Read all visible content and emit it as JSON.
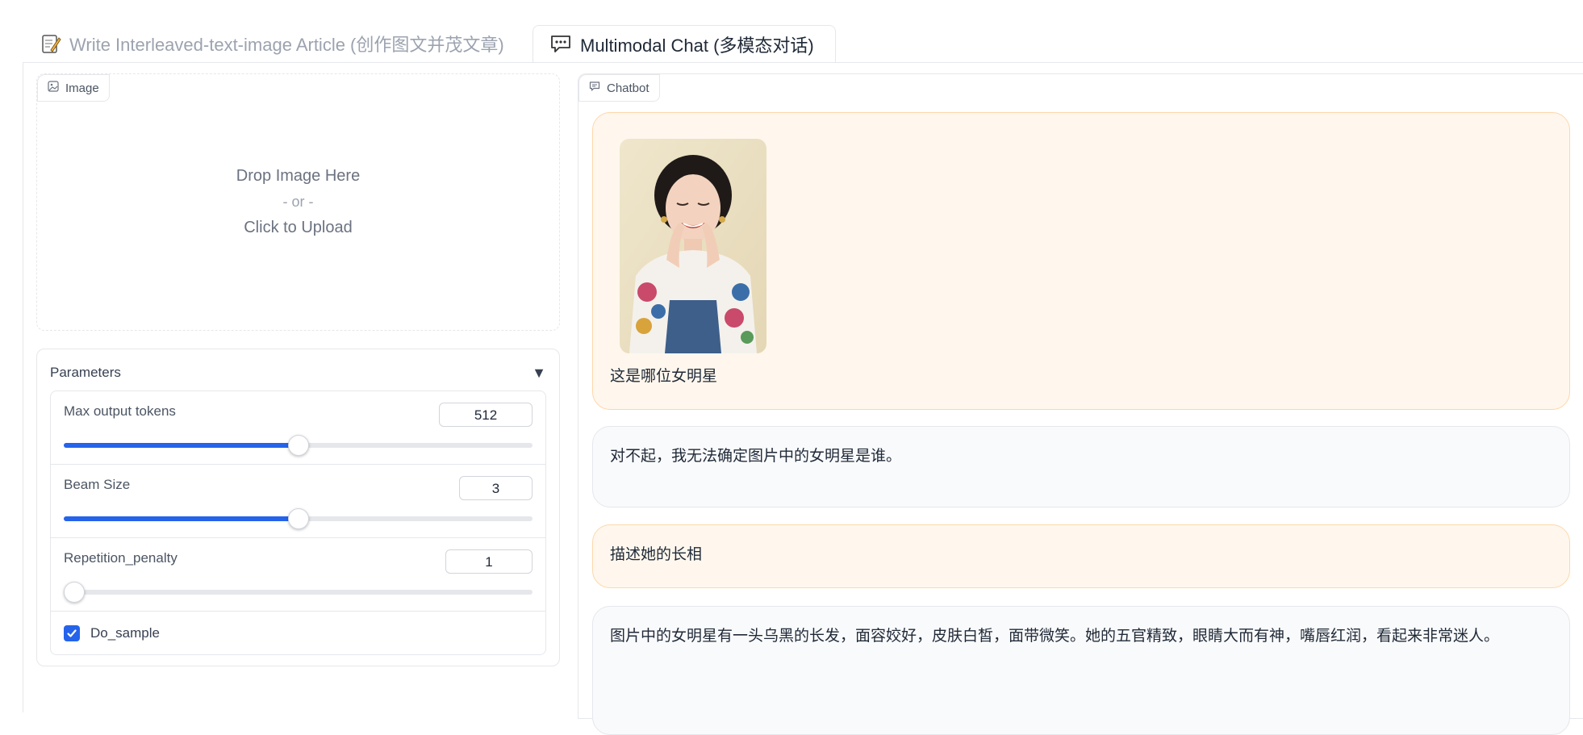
{
  "tabs": {
    "write_article": {
      "icon": "memo-icon",
      "label": "Write Interleaved-text-image Article (创作图文并茂文章)"
    },
    "multimodal_chat": {
      "icon": "speech-bubble-icon",
      "label": "Multimodal Chat (多模态对话)"
    }
  },
  "image_input": {
    "label": "Image",
    "drop_text": "Drop Image Here",
    "or_text": "- or -",
    "click_text": "Click to Upload"
  },
  "parameters": {
    "title": "Parameters",
    "max_output_tokens": {
      "label": "Max output tokens",
      "value": "512",
      "fraction": 0.5
    },
    "beam_size": {
      "label": "Beam Size",
      "value": "3",
      "fraction": 0.5
    },
    "repetition_penalty": {
      "label": "Repetition_penalty",
      "value": "1",
      "fraction": 0.0
    },
    "do_sample": {
      "label": "Do_sample",
      "checked": true
    }
  },
  "chatbot": {
    "label": "Chatbot",
    "messages": [
      {
        "role": "user",
        "has_image": true,
        "text": "这是哪位女明星"
      },
      {
        "role": "bot",
        "text": "对不起，我无法确定图片中的女明星是谁。"
      },
      {
        "role": "user",
        "text": "描述她的长相"
      },
      {
        "role": "bot",
        "text": "图片中的女明星有一头乌黑的长发，面容姣好，皮肤白皙，面带微笑。她的五官精致，眼睛大而有神，嘴唇红润，看起来非常迷人。"
      }
    ]
  },
  "colors": {
    "accent": "#2563eb",
    "user_bubble": "#fff7ed",
    "bot_bubble": "#f9fafb"
  }
}
